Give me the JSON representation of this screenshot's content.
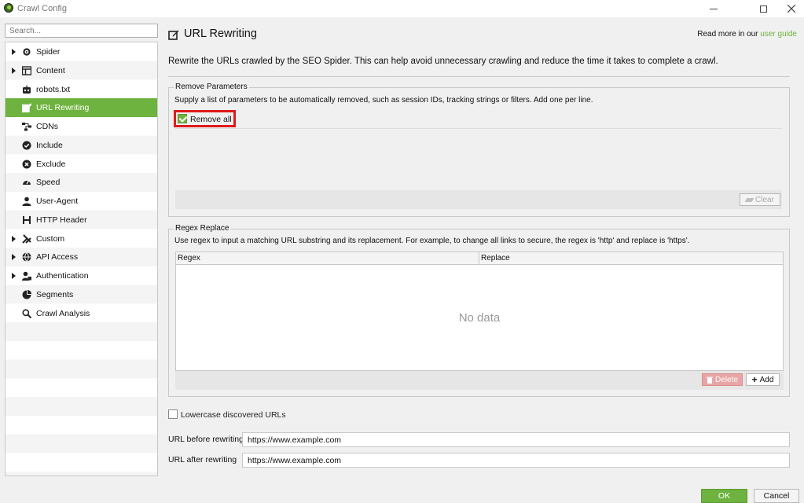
{
  "window": {
    "title": "Crawl Config"
  },
  "sidebar": {
    "search_placeholder": "Search...",
    "items": [
      {
        "label": "Spider",
        "icon": "gear-icon",
        "expandable": true
      },
      {
        "label": "Content",
        "icon": "layout-icon",
        "expandable": true
      },
      {
        "label": "robots.txt",
        "icon": "robot-icon",
        "expandable": false
      },
      {
        "label": "URL Rewriting",
        "icon": "edit-icon",
        "expandable": false,
        "active": true
      },
      {
        "label": "CDNs",
        "icon": "network-icon",
        "expandable": false
      },
      {
        "label": "Include",
        "icon": "check-circle-icon",
        "expandable": false
      },
      {
        "label": "Exclude",
        "icon": "x-circle-icon",
        "expandable": false
      },
      {
        "label": "Speed",
        "icon": "speedometer-icon",
        "expandable": false
      },
      {
        "label": "User-Agent",
        "icon": "user-icon",
        "expandable": false
      },
      {
        "label": "HTTP Header",
        "icon": "h-icon",
        "expandable": false
      },
      {
        "label": "Custom",
        "icon": "tools-icon",
        "expandable": true
      },
      {
        "label": "API Access",
        "icon": "globe-icon",
        "expandable": true
      },
      {
        "label": "Authentication",
        "icon": "user-lock-icon",
        "expandable": true
      },
      {
        "label": "Segments",
        "icon": "pie-icon",
        "expandable": false
      },
      {
        "label": "Crawl Analysis",
        "icon": "search-icon",
        "expandable": false
      }
    ]
  },
  "header": {
    "title": "URL Rewriting",
    "guide_prefix": "Read more in our ",
    "guide_link": "user guide"
  },
  "description": "Rewrite the URLs crawled by the SEO Spider. This can help avoid unnecessary crawling and reduce the time it takes to complete a crawl.",
  "remove_parameters": {
    "title": "Remove Parameters",
    "description": "Supply a list of parameters to be automatically removed, such as session IDs, tracking strings or filters. Add one per line.",
    "remove_all_label": "Remove all",
    "remove_all_checked": true,
    "clear_label": "Clear"
  },
  "regex_replace": {
    "title": "Regex Replace",
    "description": "Use regex to input a matching URL substring and its replacement. For example, to change all links to secure, the regex is 'http' and replace is 'https'.",
    "columns": [
      "Regex",
      "Replace"
    ],
    "empty_text": "No data",
    "delete_label": "Delete",
    "add_label": "Add"
  },
  "lowercase": {
    "label": "Lowercase discovered URLs",
    "checked": false
  },
  "test": {
    "before_label": "URL before rewriting",
    "before_value": "https://www.example.com",
    "after_label": "URL after rewriting",
    "after_value": "https://www.example.com"
  },
  "footer": {
    "ok_label": "OK",
    "cancel_label": "Cancel"
  },
  "colors": {
    "accent": "#6eb33f",
    "highlight": "#e01a1a",
    "danger": "#e8a5a5"
  }
}
